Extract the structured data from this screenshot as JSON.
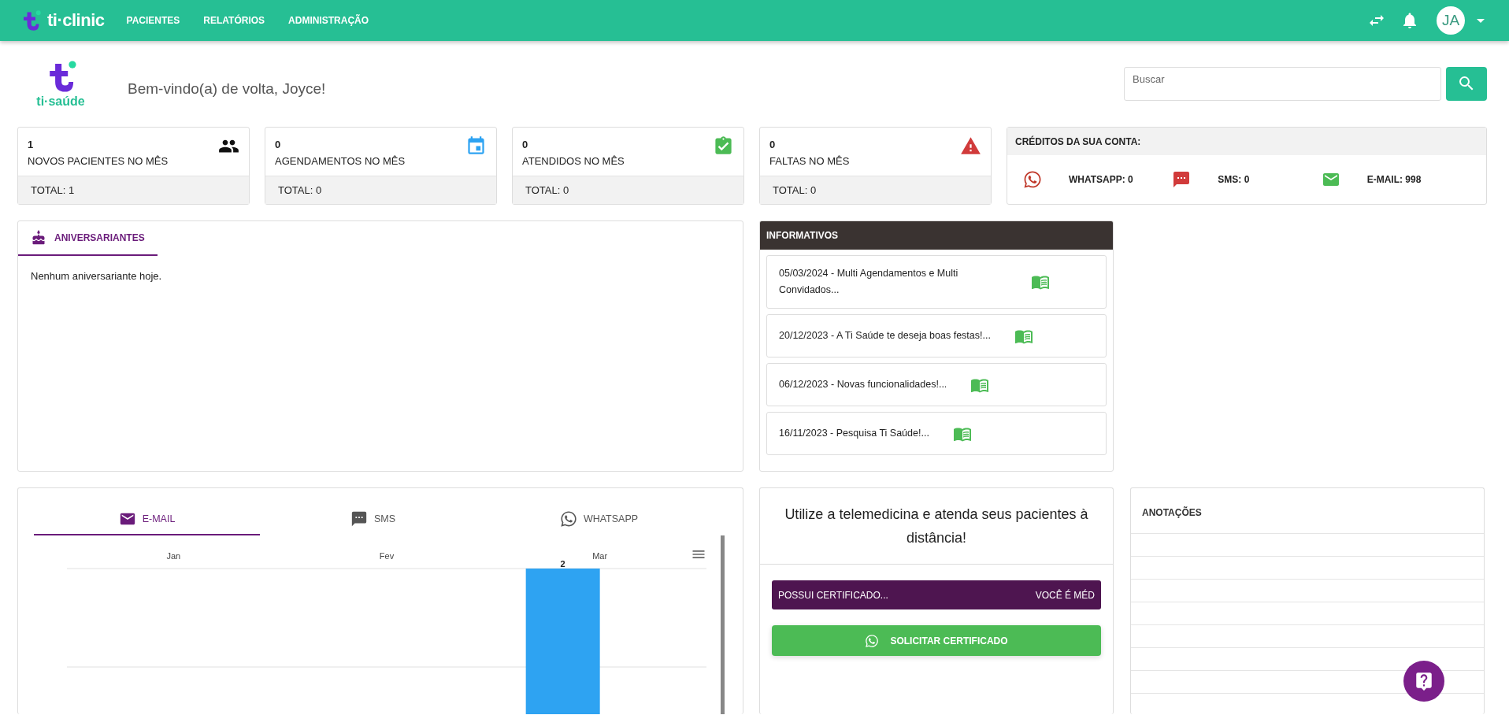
{
  "nav": {
    "brand": "ti·clinic",
    "items": [
      {
        "label": "PACIENTES"
      },
      {
        "label": "RELATÓRIOS"
      },
      {
        "label": "ADMINISTRAÇÃO"
      }
    ],
    "avatar": "JA"
  },
  "welcome": {
    "logo_text": "ti·saúde",
    "greeting": "Bem-vindo(a) de volta, Joyce!"
  },
  "search": {
    "placeholder": "Buscar"
  },
  "stats": [
    {
      "kind": "patients",
      "value": "1",
      "label": "NOVOS PACIENTES NO MÊS",
      "total": "TOTAL: 1"
    },
    {
      "kind": "appointments",
      "value": "0",
      "label": "AGENDAMENTOS NO MÊS",
      "total": "TOTAL: 0"
    },
    {
      "kind": "attended",
      "value": "0",
      "label": "ATENDIDOS NO MÊS",
      "total": "TOTAL: 0"
    },
    {
      "kind": "absences",
      "value": "0",
      "label": "FALTAS NO MÊS",
      "total": "TOTAL: 0"
    }
  ],
  "credits": {
    "title": "CRÉDITOS DA SUA CONTA:",
    "items": [
      {
        "kind": "whatsapp",
        "label": "WHATSAPP: 0"
      },
      {
        "kind": "sms",
        "label": "SMS: 0"
      },
      {
        "kind": "email",
        "label": "E-MAIL: 998"
      }
    ]
  },
  "birthdays": {
    "tab": "ANIVERSARIANTES",
    "message": "Nenhum aniversariante hoje."
  },
  "news": {
    "title": "INFORMATIVOS",
    "items": [
      {
        "text": "05/03/2024 - Multi Agendamentos e Multi Convidados..."
      },
      {
        "text": "20/12/2023 - A Ti Saúde te deseja boas festas!..."
      },
      {
        "text": "06/12/2023 - Novas funcionalidades!..."
      },
      {
        "text": "16/11/2023 - Pesquisa Ti Saúde!..."
      }
    ]
  },
  "messages": {
    "tabs": [
      {
        "kind": "email",
        "label": "E-MAIL",
        "selected": true
      },
      {
        "kind": "sms",
        "label": "SMS",
        "selected": false
      },
      {
        "kind": "whatsapp",
        "label": "WHATSAPP",
        "selected": false
      }
    ],
    "chart": {
      "months": [
        {
          "label": "Jan"
        },
        {
          "label": "Fev"
        },
        {
          "label": "Mar",
          "bar_label": "2"
        }
      ]
    }
  },
  "telemedicine": {
    "heading": "Utilize a telemedicina e atenda seus pacientes à distância!",
    "banner_left": "POSSUI CERTIFICADO...",
    "banner_right": "VOCÊ É MÉD",
    "button": "SOLICITAR CERTIFICADO"
  },
  "notes": {
    "title": "ANOTAÇÕES"
  }
}
